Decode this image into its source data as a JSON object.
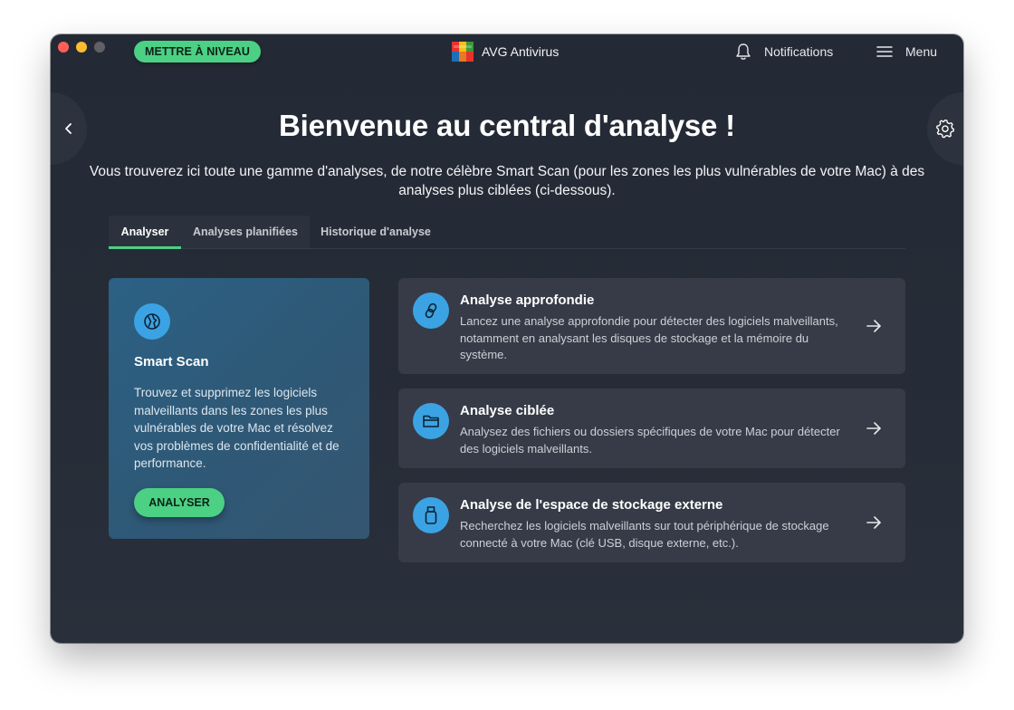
{
  "titlebar": {
    "upgrade_label": "METTRE À NIVEAU",
    "app_name": "AVG Antivirus",
    "notifications_label": "Notifications",
    "menu_label": "Menu"
  },
  "header": {
    "title": "Bienvenue au central d'analyse !",
    "subtitle": "Vous trouverez ici toute une gamme d'analyses, de notre célèbre Smart Scan (pour les zones les plus vulnérables de votre Mac) à des analyses plus ciblées (ci-dessous)."
  },
  "tabs": [
    {
      "label": "Analyser",
      "active": true
    },
    {
      "label": "Analyses planifiées",
      "active": false
    },
    {
      "label": "Historique d'analyse",
      "active": false
    }
  ],
  "smart_scan": {
    "title": "Smart Scan",
    "description": "Trouvez et supprimez les logiciels malveillants dans les zones les plus vulnérables de votre Mac et résolvez vos problèmes de confidentialité et de performance.",
    "button_label": "ANALYSER"
  },
  "scans": [
    {
      "title": "Analyse approfondie",
      "description": "Lancez une analyse approfondie pour détecter des logiciels malveillants, notamment en analysant les disques de stockage et la mémoire du système.",
      "icon": "chain-link-icon"
    },
    {
      "title": "Analyse ciblée",
      "description": "Analysez des fichiers ou dossiers spécifiques de votre Mac pour détecter des logiciels malveillants.",
      "icon": "folder-icon"
    },
    {
      "title": "Analyse de l'espace de stockage externe",
      "description": "Recherchez les logiciels malveillants sur tout périphérique de stockage connecté à votre Mac (clé USB, disque externe, etc.).",
      "icon": "usb-drive-icon"
    }
  ],
  "colors": {
    "accent_green": "#4bd084",
    "icon_blue": "#3ba3e3",
    "background": "#262c37",
    "card": "#363b47",
    "smart_card": "#2e5977"
  }
}
